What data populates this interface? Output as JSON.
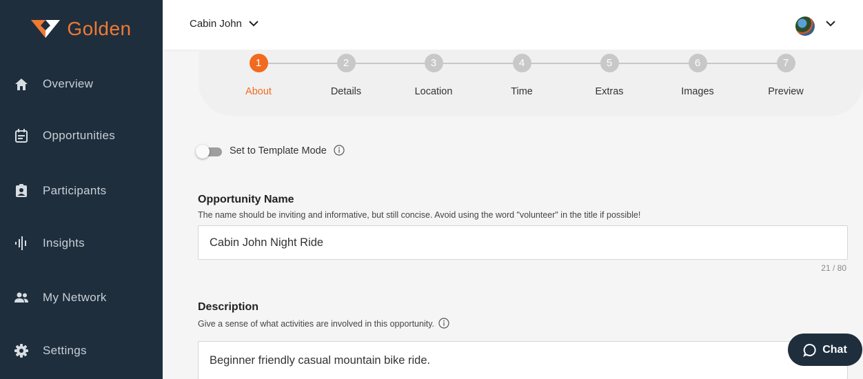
{
  "brand": {
    "name": "Golden",
    "accent": "#f07a33"
  },
  "sidebar": {
    "items": [
      {
        "label": "Overview",
        "icon": "home-icon"
      },
      {
        "label": "Opportunities",
        "icon": "calendar-icon"
      },
      {
        "label": "Participants",
        "icon": "badge-icon"
      },
      {
        "label": "Insights",
        "icon": "waveform-icon"
      },
      {
        "label": "My Network",
        "icon": "people-icon"
      },
      {
        "label": "Settings",
        "icon": "gear-icon"
      }
    ]
  },
  "topbar": {
    "org_name": "Cabin John"
  },
  "stepper": {
    "steps": [
      {
        "number": "1",
        "label": "About",
        "active": true
      },
      {
        "number": "2",
        "label": "Details"
      },
      {
        "number": "3",
        "label": "Location"
      },
      {
        "number": "4",
        "label": "Time"
      },
      {
        "number": "5",
        "label": "Extras"
      },
      {
        "number": "6",
        "label": "Images"
      },
      {
        "number": "7",
        "label": "Preview"
      }
    ]
  },
  "template_mode": {
    "label": "Set to Template Mode",
    "enabled": false
  },
  "opportunity_name": {
    "title": "Opportunity Name",
    "help": "The name should be inviting and informative, but still concise. Avoid using the word \"volunteer\" in the title if possible!",
    "value": "Cabin John Night Ride",
    "count": "21 / 80"
  },
  "description": {
    "title": "Description",
    "help": "Give a sense of what activities are involved in this opportunity.",
    "value": "Beginner friendly casual mountain bike ride."
  },
  "chat": {
    "label": "Chat"
  }
}
